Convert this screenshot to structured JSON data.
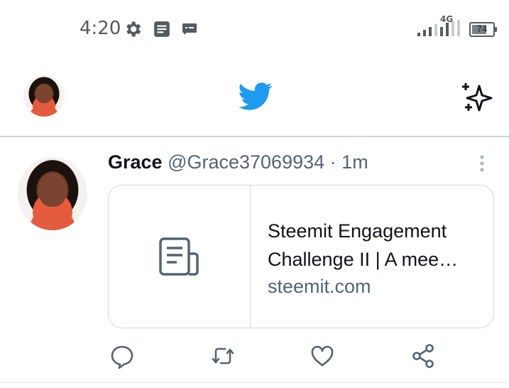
{
  "status_bar": {
    "time": "4:20",
    "network": "4G",
    "battery": "74",
    "icons": [
      "settings-icon",
      "notes-icon",
      "message-icon",
      "signal-icon",
      "battery-icon"
    ]
  },
  "header": {
    "logo": "twitter-bird-icon",
    "action_icon": "sparkle-icon",
    "brand_color": "#1d9bf0"
  },
  "tweet": {
    "author_name": "Grace",
    "author_handle": "@Grace37069934",
    "separator": "·",
    "time_ago": "1m",
    "card": {
      "title": "Steemit Engagement Challenge II | A mee…",
      "domain": "steemit.com",
      "thumb_icon": "article-icon"
    },
    "actions": [
      "reply-icon",
      "retweet-icon",
      "like-icon",
      "share-icon"
    ]
  },
  "colors": {
    "text_primary": "#0f1419",
    "text_secondary": "#536471",
    "border": "#cfd9de"
  }
}
